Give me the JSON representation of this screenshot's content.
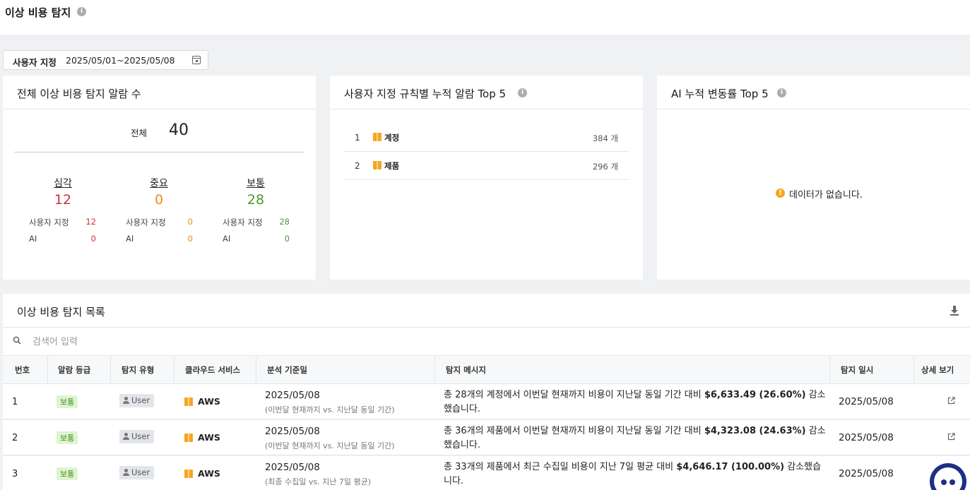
{
  "page": {
    "title": "이상 비용 탐지"
  },
  "filter": {
    "label": "사용자 지정",
    "date_range": "2025/05/01~2025/05/08"
  },
  "summary_card": {
    "title": "전체 이상 비용 탐지 알람 수",
    "total_label": "전체",
    "total_value": "40",
    "severities": [
      {
        "label": "심각",
        "value": "12",
        "user_label": "사용자 지정",
        "user_value": "12",
        "ai_label": "AI",
        "ai_value": "0",
        "color": "#d1303b"
      },
      {
        "label": "중요",
        "value": "0",
        "user_label": "사용자 지정",
        "user_value": "0",
        "ai_label": "AI",
        "ai_value": "0",
        "color": "#ec8c1d"
      },
      {
        "label": "보통",
        "value": "28",
        "user_label": "사용자 지정",
        "user_value": "28",
        "ai_label": "AI",
        "ai_value": "0",
        "color": "#4d9a2a"
      }
    ]
  },
  "rules_card": {
    "title": "사용자 지정 규칙별 누적 알람 Top 5",
    "items": [
      {
        "rank": "1",
        "name": "계정",
        "count": "384 개"
      },
      {
        "rank": "2",
        "name": "제품",
        "count": "296 개"
      }
    ]
  },
  "ai_card": {
    "title": "AI 누적 변동률 Top 5",
    "empty_text": "데이터가 없습니다."
  },
  "list": {
    "title": "이상 비용 탐지 목록",
    "search_placeholder": "검색어 입력",
    "columns": [
      "번호",
      "알람 등급",
      "탐지 유형",
      "클라우드 서비스",
      "분석 기준일",
      "탐지 메시지",
      "탐지 일시",
      "상세 보기"
    ],
    "rows": [
      {
        "num": "1",
        "grade": "보통",
        "type": "User",
        "cloud": "AWS",
        "date": "2025/05/08",
        "date_note": "(이번달 현재까지 vs. 지난달 동일 기간)",
        "msg_pre": "총 28개의 계정에서 이번달 현재까지 비용이 지난달 동일 기간 대비 ",
        "msg_amount": "$6,633.49 (26.60%)",
        "msg_post": " 감소했습니다.",
        "detected": "2025/05/08"
      },
      {
        "num": "2",
        "grade": "보통",
        "type": "User",
        "cloud": "AWS",
        "date": "2025/05/08",
        "date_note": "(이번달 현재까지 vs. 지난달 동일 기간)",
        "msg_pre": "총 36개의 제품에서 이번달 현재까지 비용이 지난달 동일 기간 대비 ",
        "msg_amount": "$4,323.08 (24.63%)",
        "msg_post": " 감소했습니다.",
        "detected": "2025/05/08"
      },
      {
        "num": "3",
        "grade": "보통",
        "type": "User",
        "cloud": "AWS",
        "date": "2025/05/08",
        "date_note": "(최종 수집일 vs. 지난 7일 평균)",
        "msg_pre": "총 33개의 제품에서 최근 수집일 비용이 지난 7일 평균 대비 ",
        "msg_amount": "$4,646.17 (100.00%)",
        "msg_post": " 감소했습니다.",
        "detected": "2025/05/08"
      }
    ]
  },
  "colors": {
    "badge_bg": "#dff4cf",
    "badge_text": "#3b8a1b",
    "aws": "#f5a623",
    "chat": "#1e2f86"
  }
}
